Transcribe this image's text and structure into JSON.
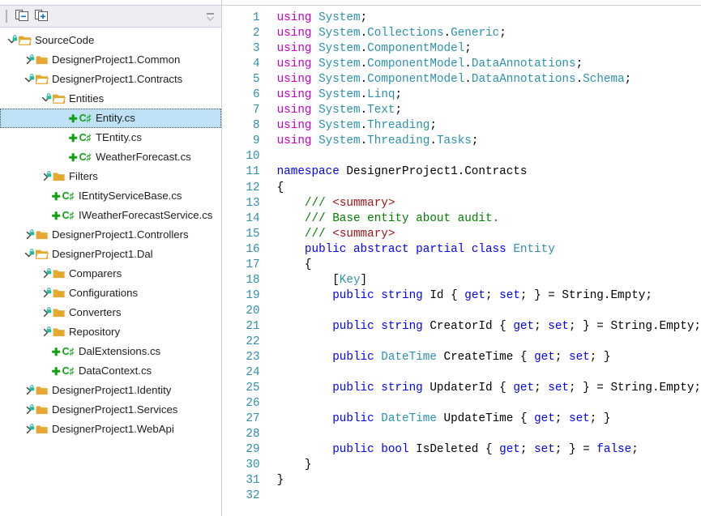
{
  "sidebar": {
    "toolbar": {
      "drag_handle": "drag-handle",
      "collapse_all_label": "Collapse All",
      "expand_all_label": "Expand All",
      "overflow_label": "More"
    },
    "tree": [
      {
        "label": "SourceCode",
        "depth": 0,
        "icon": "folder-open",
        "state": "expanded",
        "locked": true,
        "selected": false
      },
      {
        "label": "DesignerProject1.Common",
        "depth": 1,
        "icon": "folder-closed",
        "state": "collapsed",
        "locked": true,
        "selected": false
      },
      {
        "label": "DesignerProject1.Contracts",
        "depth": 1,
        "icon": "folder-open",
        "state": "expanded",
        "locked": true,
        "selected": false
      },
      {
        "label": "Entities",
        "depth": 2,
        "icon": "folder-open",
        "state": "expanded",
        "locked": true,
        "selected": false
      },
      {
        "label": "Entity.cs",
        "depth": 3,
        "icon": "csharp-file",
        "state": "leaf",
        "locked": false,
        "selected": true
      },
      {
        "label": "TEntity.cs",
        "depth": 3,
        "icon": "csharp-file",
        "state": "leaf",
        "locked": false,
        "selected": false
      },
      {
        "label": "WeatherForecast.cs",
        "depth": 3,
        "icon": "csharp-file",
        "state": "leaf",
        "locked": false,
        "selected": false
      },
      {
        "label": "Filters",
        "depth": 2,
        "icon": "folder-closed",
        "state": "collapsed",
        "locked": true,
        "selected": false
      },
      {
        "label": "IEntityServiceBase.cs",
        "depth": 2,
        "icon": "csharp-file",
        "state": "leaf",
        "locked": false,
        "selected": false
      },
      {
        "label": "IWeatherForecastService.cs",
        "depth": 2,
        "icon": "csharp-file",
        "state": "leaf",
        "locked": false,
        "selected": false
      },
      {
        "label": "DesignerProject1.Controllers",
        "depth": 1,
        "icon": "folder-closed",
        "state": "collapsed",
        "locked": true,
        "selected": false
      },
      {
        "label": "DesignerProject1.Dal",
        "depth": 1,
        "icon": "folder-open",
        "state": "expanded",
        "locked": true,
        "selected": false
      },
      {
        "label": "Comparers",
        "depth": 2,
        "icon": "folder-closed",
        "state": "collapsed",
        "locked": true,
        "selected": false
      },
      {
        "label": "Configurations",
        "depth": 2,
        "icon": "folder-closed",
        "state": "collapsed",
        "locked": true,
        "selected": false
      },
      {
        "label": "Converters",
        "depth": 2,
        "icon": "folder-closed",
        "state": "collapsed",
        "locked": true,
        "selected": false
      },
      {
        "label": "Repository",
        "depth": 2,
        "icon": "folder-closed",
        "state": "collapsed",
        "locked": true,
        "selected": false
      },
      {
        "label": "DalExtensions.cs",
        "depth": 2,
        "icon": "csharp-file",
        "state": "leaf",
        "locked": false,
        "selected": false
      },
      {
        "label": "DataContext.cs",
        "depth": 2,
        "icon": "csharp-file",
        "state": "leaf",
        "locked": false,
        "selected": false
      },
      {
        "label": "DesignerProject1.Identity",
        "depth": 1,
        "icon": "folder-closed",
        "state": "collapsed",
        "locked": true,
        "selected": false
      },
      {
        "label": "DesignerProject1.Services",
        "depth": 1,
        "icon": "folder-closed",
        "state": "collapsed",
        "locked": true,
        "selected": false
      },
      {
        "label": "DesignerProject1.WebApi",
        "depth": 1,
        "icon": "folder-closed",
        "state": "collapsed",
        "locked": true,
        "selected": false
      }
    ]
  },
  "editor": {
    "language": "csharp",
    "line_count": 32,
    "colors": {
      "keyword": "#0000FF",
      "using_keyword": "#C700C7",
      "type": "#2B91AF",
      "comment": "#008000",
      "xml_doc_tag": "#A31515",
      "line_number": "#2B91AF",
      "plain": "#000000",
      "selection": "#BFE1F5",
      "folder": "#E5A72F",
      "lock_badge": "#1BBC9B"
    },
    "lines": [
      {
        "n": "1",
        "tokens": [
          {
            "t": "using",
            "c": "kp"
          },
          {
            "t": " ",
            "c": "p"
          },
          {
            "t": "System",
            "c": "ns"
          },
          {
            "t": ";",
            "c": "p"
          }
        ]
      },
      {
        "n": "2",
        "tokens": [
          {
            "t": "using",
            "c": "kp"
          },
          {
            "t": " ",
            "c": "p"
          },
          {
            "t": "System",
            "c": "ns"
          },
          {
            "t": ".",
            "c": "p"
          },
          {
            "t": "Collections",
            "c": "ns"
          },
          {
            "t": ".",
            "c": "p"
          },
          {
            "t": "Generic",
            "c": "ns"
          },
          {
            "t": ";",
            "c": "p"
          }
        ]
      },
      {
        "n": "3",
        "tokens": [
          {
            "t": "using",
            "c": "kp"
          },
          {
            "t": " ",
            "c": "p"
          },
          {
            "t": "System",
            "c": "ns"
          },
          {
            "t": ".",
            "c": "p"
          },
          {
            "t": "ComponentModel",
            "c": "ns"
          },
          {
            "t": ";",
            "c": "p"
          }
        ]
      },
      {
        "n": "4",
        "tokens": [
          {
            "t": "using",
            "c": "kp"
          },
          {
            "t": " ",
            "c": "p"
          },
          {
            "t": "System",
            "c": "ns"
          },
          {
            "t": ".",
            "c": "p"
          },
          {
            "t": "ComponentModel",
            "c": "ns"
          },
          {
            "t": ".",
            "c": "p"
          },
          {
            "t": "DataAnnotations",
            "c": "ns"
          },
          {
            "t": ";",
            "c": "p"
          }
        ]
      },
      {
        "n": "5",
        "tokens": [
          {
            "t": "using",
            "c": "kp"
          },
          {
            "t": " ",
            "c": "p"
          },
          {
            "t": "System",
            "c": "ns"
          },
          {
            "t": ".",
            "c": "p"
          },
          {
            "t": "ComponentModel",
            "c": "ns"
          },
          {
            "t": ".",
            "c": "p"
          },
          {
            "t": "DataAnnotations",
            "c": "ns"
          },
          {
            "t": ".",
            "c": "p"
          },
          {
            "t": "Schema",
            "c": "ns"
          },
          {
            "t": ";",
            "c": "p"
          }
        ]
      },
      {
        "n": "6",
        "tokens": [
          {
            "t": "using",
            "c": "kp"
          },
          {
            "t": " ",
            "c": "p"
          },
          {
            "t": "System",
            "c": "ns"
          },
          {
            "t": ".",
            "c": "p"
          },
          {
            "t": "Linq",
            "c": "ns"
          },
          {
            "t": ";",
            "c": "p"
          }
        ]
      },
      {
        "n": "7",
        "tokens": [
          {
            "t": "using",
            "c": "kp"
          },
          {
            "t": " ",
            "c": "p"
          },
          {
            "t": "System",
            "c": "ns"
          },
          {
            "t": ".",
            "c": "p"
          },
          {
            "t": "Text",
            "c": "ns"
          },
          {
            "t": ";",
            "c": "p"
          }
        ]
      },
      {
        "n": "8",
        "tokens": [
          {
            "t": "using",
            "c": "kp"
          },
          {
            "t": " ",
            "c": "p"
          },
          {
            "t": "System",
            "c": "ns"
          },
          {
            "t": ".",
            "c": "p"
          },
          {
            "t": "Threading",
            "c": "ns"
          },
          {
            "t": ";",
            "c": "p"
          }
        ]
      },
      {
        "n": "9",
        "tokens": [
          {
            "t": "using",
            "c": "kp"
          },
          {
            "t": " ",
            "c": "p"
          },
          {
            "t": "System",
            "c": "ns"
          },
          {
            "t": ".",
            "c": "p"
          },
          {
            "t": "Threading",
            "c": "ns"
          },
          {
            "t": ".",
            "c": "p"
          },
          {
            "t": "Tasks",
            "c": "ns"
          },
          {
            "t": ";",
            "c": "p"
          }
        ]
      },
      {
        "n": "10",
        "tokens": []
      },
      {
        "n": "11",
        "tokens": [
          {
            "t": "namespace",
            "c": "k"
          },
          {
            "t": " DesignerProject1.Contracts",
            "c": "p"
          }
        ]
      },
      {
        "n": "12",
        "tokens": [
          {
            "t": "{",
            "c": "p"
          }
        ]
      },
      {
        "n": "13",
        "tokens": [
          {
            "t": "    ",
            "c": "p"
          },
          {
            "t": "/// ",
            "c": "c"
          },
          {
            "t": "<summary>",
            "c": "x"
          }
        ]
      },
      {
        "n": "14",
        "tokens": [
          {
            "t": "    ",
            "c": "p"
          },
          {
            "t": "/// Base entity about audit.",
            "c": "c"
          }
        ]
      },
      {
        "n": "15",
        "tokens": [
          {
            "t": "    ",
            "c": "p"
          },
          {
            "t": "/// ",
            "c": "c"
          },
          {
            "t": "<summary>",
            "c": "x"
          }
        ]
      },
      {
        "n": "16",
        "tokens": [
          {
            "t": "    ",
            "c": "p"
          },
          {
            "t": "public abstract partial class",
            "c": "k"
          },
          {
            "t": " ",
            "c": "p"
          },
          {
            "t": "Entity",
            "c": "t"
          }
        ]
      },
      {
        "n": "17",
        "tokens": [
          {
            "t": "    {",
            "c": "p"
          }
        ]
      },
      {
        "n": "18",
        "tokens": [
          {
            "t": "        [",
            "c": "p"
          },
          {
            "t": "Key",
            "c": "t"
          },
          {
            "t": "]",
            "c": "p"
          }
        ]
      },
      {
        "n": "19",
        "tokens": [
          {
            "t": "        ",
            "c": "p"
          },
          {
            "t": "public string",
            "c": "k"
          },
          {
            "t": " Id { ",
            "c": "p"
          },
          {
            "t": "get",
            "c": "k"
          },
          {
            "t": "; ",
            "c": "p"
          },
          {
            "t": "set",
            "c": "k"
          },
          {
            "t": "; } = String.Empty;",
            "c": "p"
          }
        ]
      },
      {
        "n": "20",
        "tokens": []
      },
      {
        "n": "21",
        "tokens": [
          {
            "t": "        ",
            "c": "p"
          },
          {
            "t": "public string",
            "c": "k"
          },
          {
            "t": " CreatorId { ",
            "c": "p"
          },
          {
            "t": "get",
            "c": "k"
          },
          {
            "t": "; ",
            "c": "p"
          },
          {
            "t": "set",
            "c": "k"
          },
          {
            "t": "; } = String.Empty;",
            "c": "p"
          }
        ]
      },
      {
        "n": "22",
        "tokens": []
      },
      {
        "n": "23",
        "tokens": [
          {
            "t": "        ",
            "c": "p"
          },
          {
            "t": "public",
            "c": "k"
          },
          {
            "t": " ",
            "c": "p"
          },
          {
            "t": "DateTime",
            "c": "t"
          },
          {
            "t": " CreateTime { ",
            "c": "p"
          },
          {
            "t": "get",
            "c": "k"
          },
          {
            "t": "; ",
            "c": "p"
          },
          {
            "t": "set",
            "c": "k"
          },
          {
            "t": "; }",
            "c": "p"
          }
        ]
      },
      {
        "n": "24",
        "tokens": []
      },
      {
        "n": "25",
        "tokens": [
          {
            "t": "        ",
            "c": "p"
          },
          {
            "t": "public string",
            "c": "k"
          },
          {
            "t": " UpdaterId { ",
            "c": "p"
          },
          {
            "t": "get",
            "c": "k"
          },
          {
            "t": "; ",
            "c": "p"
          },
          {
            "t": "set",
            "c": "k"
          },
          {
            "t": "; } = String.Empty;",
            "c": "p"
          }
        ]
      },
      {
        "n": "26",
        "tokens": []
      },
      {
        "n": "27",
        "tokens": [
          {
            "t": "        ",
            "c": "p"
          },
          {
            "t": "public",
            "c": "k"
          },
          {
            "t": " ",
            "c": "p"
          },
          {
            "t": "DateTime",
            "c": "t"
          },
          {
            "t": " UpdateTime { ",
            "c": "p"
          },
          {
            "t": "get",
            "c": "k"
          },
          {
            "t": "; ",
            "c": "p"
          },
          {
            "t": "set",
            "c": "k"
          },
          {
            "t": "; }",
            "c": "p"
          }
        ]
      },
      {
        "n": "28",
        "tokens": []
      },
      {
        "n": "29",
        "tokens": [
          {
            "t": "        ",
            "c": "p"
          },
          {
            "t": "public bool",
            "c": "k"
          },
          {
            "t": " IsDeleted { ",
            "c": "p"
          },
          {
            "t": "get",
            "c": "k"
          },
          {
            "t": "; ",
            "c": "p"
          },
          {
            "t": "set",
            "c": "k"
          },
          {
            "t": "; } = ",
            "c": "p"
          },
          {
            "t": "false",
            "c": "k"
          },
          {
            "t": ";",
            "c": "p"
          }
        ]
      },
      {
        "n": "30",
        "tokens": [
          {
            "t": "    }",
            "c": "p"
          }
        ]
      },
      {
        "n": "31",
        "tokens": [
          {
            "t": "}",
            "c": "p"
          }
        ]
      },
      {
        "n": "32",
        "tokens": []
      }
    ]
  }
}
